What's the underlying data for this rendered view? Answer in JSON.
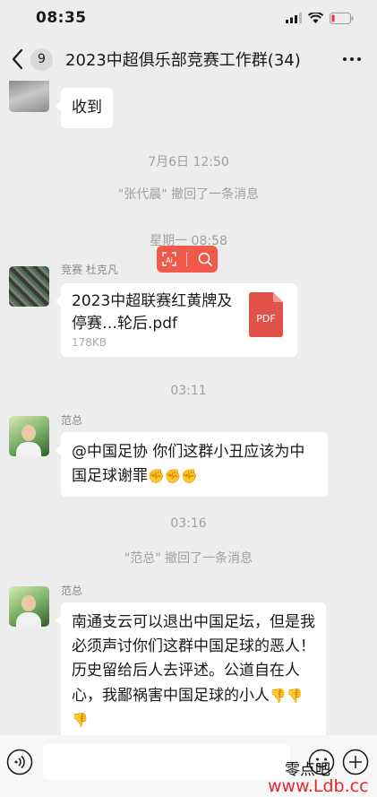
{
  "status_bar": {
    "time": "08:35"
  },
  "nav": {
    "badge": "9",
    "title": "2023中超俱乐部竞赛工作群(34)"
  },
  "messages": {
    "m1": {
      "text": "收到"
    },
    "ts1": "7月6日 12:50",
    "recall1": "\"张代晨\" 撤回了一条消息",
    "ts2": "星期一 08:58",
    "m2": {
      "sender": "竞赛 杜克凡",
      "file_name": "2023中超联赛红黄牌及停赛…轮后.pdf",
      "file_size": "178KB",
      "file_type": "PDF"
    },
    "ts3": "03:11",
    "m3": {
      "sender": "范总",
      "text": "@中国足协 你们这群小丑应该为中国足球谢罪",
      "emoji": "✊✊✊"
    },
    "ts4": "03:16",
    "recall2": "\"范总\" 撤回了一条消息",
    "m4": {
      "sender": "范总",
      "text": "南通支云可以退出中国足坛，但是我必须声讨你们这群中国足球的恶人！历史留给后人去评述。公道自在人心，我鄙祸害中国足球的小人",
      "emoji": "👎👎👎"
    }
  },
  "float_tools": {
    "icons": [
      "text-extract-icon",
      "search-icon"
    ]
  },
  "input_bar": {
    "icons": [
      "voice-icon",
      "emoji-icon",
      "plus-icon"
    ]
  },
  "watermark": {
    "text": "零点吧",
    "url": "www.Ldb.cc"
  },
  "colors": {
    "background": "#ededed",
    "bubble": "#ffffff",
    "accent": "#f15a4a",
    "pdf": "#e0524a"
  }
}
